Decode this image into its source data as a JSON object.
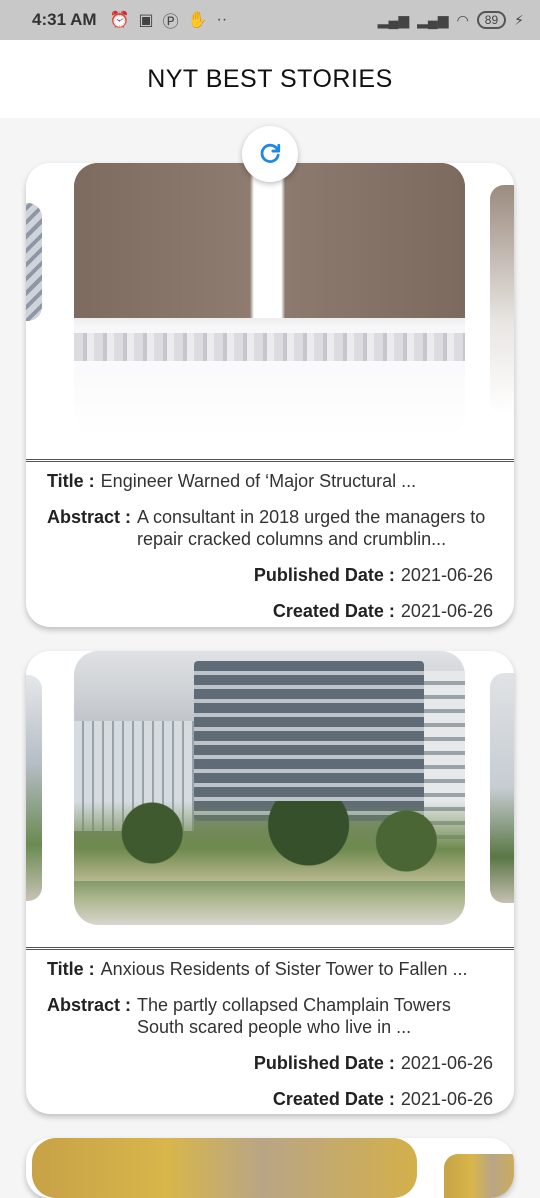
{
  "status_bar": {
    "time": "4:31 AM",
    "battery": "89"
  },
  "app_bar": {
    "title": "NYT BEST STORIES"
  },
  "labels": {
    "title": "Title :",
    "abstract": "Abstract :",
    "published": "Published Date :",
    "created": "Created Date :"
  },
  "stories": [
    {
      "title": "Engineer Warned of ‘Major Structural ...",
      "abstract": "A consultant in 2018 urged the managers to repair cracked columns and crumblin...",
      "published_date": "2021-06-26",
      "created_date": "2021-06-26"
    },
    {
      "title": "Anxious Residents of Sister Tower to Fallen ...",
      "abstract": "The partly collapsed Champlain Towers South scared people who live in ...",
      "published_date": "2021-06-26",
      "created_date": "2021-06-26"
    }
  ],
  "colors": {
    "accent": "#1e88e5",
    "card_bg": "#ffffff",
    "page_bg": "#f5f5f5"
  }
}
